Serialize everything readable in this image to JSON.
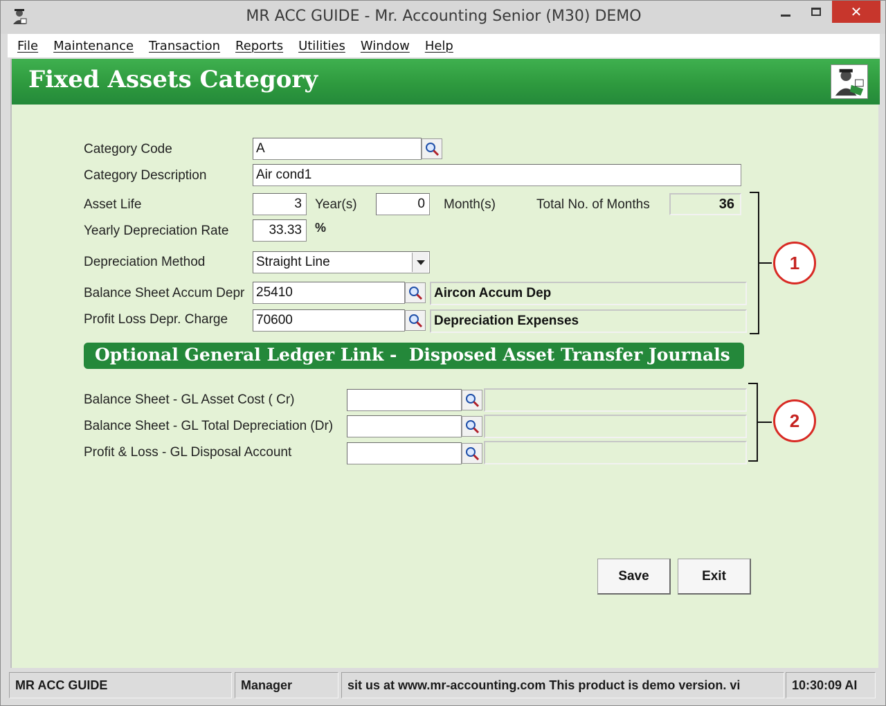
{
  "window": {
    "title": "MR ACC GUIDE - Mr. Accounting Senior (M30) DEMO",
    "close_glyph": "✕"
  },
  "menu": [
    "File",
    "Maintenance",
    "Transaction",
    "Reports",
    "Utilities",
    "Window",
    "Help"
  ],
  "banner": {
    "title": "Fixed Assets Category"
  },
  "form": {
    "category_code_label": "Category Code",
    "category_code_value": "A",
    "category_description_label": "Category Description",
    "category_description_value": "Air cond1",
    "asset_life_label": "Asset Life",
    "years_value": "3",
    "years_label": "Year(s)",
    "months_value": "0",
    "months_label": "Month(s)",
    "total_months_label": "Total No. of Months",
    "total_months_value": "36",
    "depreciation_rate_label": "Yearly Depreciation Rate",
    "depreciation_rate_value": "33.33",
    "percent_symbol": "%",
    "depreciation_method_label": "Depreciation Method",
    "depreciation_method_value": "Straight Line",
    "bs_accum_depr_label": "Balance Sheet Accum Depr",
    "bs_accum_depr_code": "25410",
    "bs_accum_depr_name": "Aircon Accum Dep",
    "pl_depr_charge_label": "Profit  Loss Depr. Charge",
    "pl_depr_charge_code": "70600",
    "pl_depr_charge_name": "Depreciation Expenses"
  },
  "gl_link": {
    "section_title": "Optional General Ledger Link -  Disposed Asset Transfer Journals",
    "asset_cost_label": "Balance Sheet - GL Asset Cost ( Cr)",
    "asset_cost_code": "",
    "asset_cost_name": "",
    "total_depr_label": "Balance Sheet - GL Total Depreciation (Dr)",
    "total_depr_code": "",
    "total_depr_name": "",
    "disposal_label": "Profit & Loss - GL Disposal Account",
    "disposal_code": "",
    "disposal_name": ""
  },
  "callouts": {
    "one": "1",
    "two": "2"
  },
  "buttons": {
    "save": "Save",
    "exit": "Exit"
  },
  "statusbar": {
    "company": "MR ACC GUIDE",
    "user": "Manager",
    "message": "sit us at www.mr-accounting.com This product is demo version.  vi",
    "time": "10:30:09 AI"
  },
  "colors": {
    "banner_green": "#2e9a3e",
    "form_background": "#e4f2d6",
    "close_red": "#c7362c",
    "callout_red": "#d82a24"
  }
}
